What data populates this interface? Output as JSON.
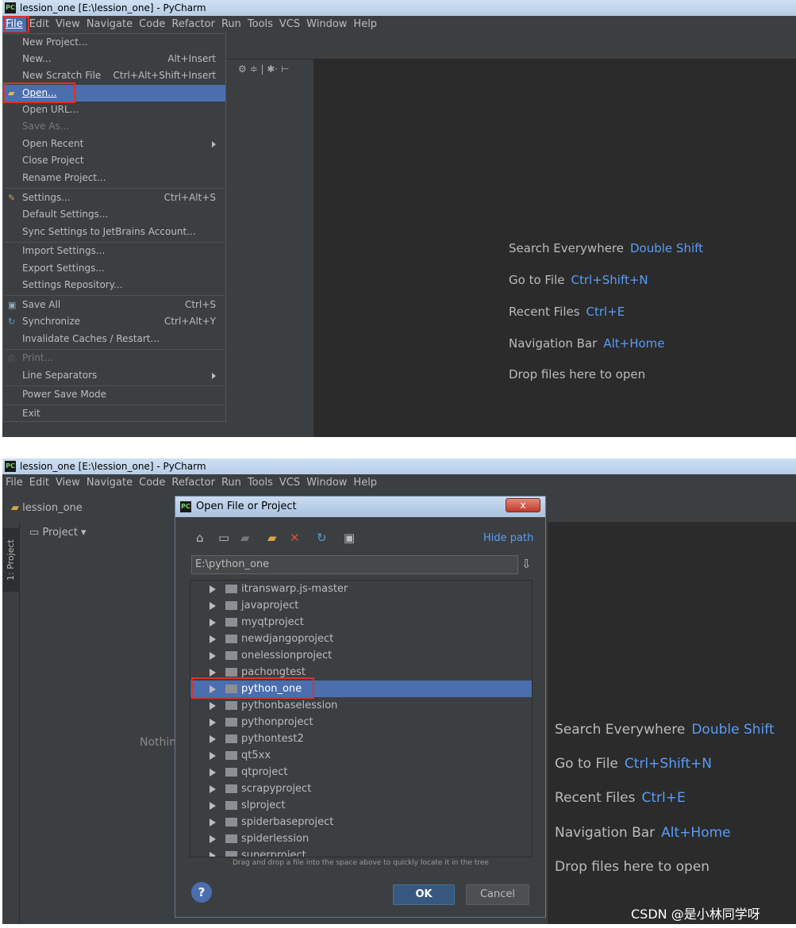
{
  "top": {
    "window_title": "lession_one [E:\\lession_one] - PyCharm",
    "menus": [
      "File",
      "Edit",
      "View",
      "Navigate",
      "Code",
      "Refactor",
      "Run",
      "Tools",
      "VCS",
      "Window",
      "Help"
    ],
    "file_menu": [
      {
        "label": "New Project...",
        "shortcut": ""
      },
      {
        "label": "New...",
        "shortcut": "Alt+Insert"
      },
      {
        "label": "New Scratch File",
        "shortcut": "Ctrl+Alt+Shift+Insert"
      },
      {
        "label": "Open...",
        "shortcut": ""
      },
      {
        "label": "Open URL...",
        "shortcut": ""
      },
      {
        "label": "Save As...",
        "shortcut": ""
      },
      {
        "label": "Open Recent",
        "shortcut": ""
      },
      {
        "label": "Close Project",
        "shortcut": ""
      },
      {
        "label": "Rename Project...",
        "shortcut": ""
      },
      {
        "label": "Settings...",
        "shortcut": "Ctrl+Alt+S"
      },
      {
        "label": "Default Settings...",
        "shortcut": ""
      },
      {
        "label": "Sync Settings to JetBrains Account...",
        "shortcut": ""
      },
      {
        "label": "Import Settings...",
        "shortcut": ""
      },
      {
        "label": "Export Settings...",
        "shortcut": ""
      },
      {
        "label": "Settings Repository...",
        "shortcut": ""
      },
      {
        "label": "Save All",
        "shortcut": "Ctrl+S"
      },
      {
        "label": "Synchronize",
        "shortcut": "Ctrl+Alt+Y"
      },
      {
        "label": "Invalidate Caches / Restart...",
        "shortcut": ""
      },
      {
        "label": "Print...",
        "shortcut": ""
      },
      {
        "label": "Line Separators",
        "shortcut": ""
      },
      {
        "label": "Power Save Mode",
        "shortcut": ""
      },
      {
        "label": "Exit",
        "shortcut": ""
      }
    ],
    "hints": [
      {
        "label": "Search Everywhere",
        "key": "Double Shift"
      },
      {
        "label": "Go to File",
        "key": "Ctrl+Shift+N"
      },
      {
        "label": "Recent Files",
        "key": "Ctrl+E"
      },
      {
        "label": "Navigation Bar",
        "key": "Alt+Home"
      },
      {
        "label": "Drop files here to open",
        "key": ""
      }
    ]
  },
  "bottom": {
    "window_title": "lession_one [E:\\lession_one] - PyCharm",
    "menus": [
      "File",
      "Edit",
      "View",
      "Navigate",
      "Code",
      "Refactor",
      "Run",
      "Tools",
      "VCS",
      "Window",
      "Help"
    ],
    "breadcrumb": "lession_one",
    "side_tab": "1: Project",
    "project_selector": "Project",
    "nothing_text": "Nothin",
    "dialog": {
      "title": "Open File or Project",
      "close_label": "x",
      "hide_path": "Hide path",
      "path_value": "E:\\python_one",
      "items": [
        "itranswarp.js-master",
        "javaproject",
        "myqtproject",
        "newdjangoproject",
        "onelessionproject",
        "pachongtest",
        "python_one",
        "pythonbaselession",
        "pythonproject",
        "pythontest2",
        "qt5xx",
        "qtproject",
        "scrapyproject",
        "slproject",
        "spiderbaseproject",
        "spiderlession",
        "superproject"
      ],
      "selected_item": "python_one",
      "drag_hint": "Drag and drop a file into the space above to quickly locate it in the tree",
      "help_label": "?",
      "ok_label": "OK",
      "cancel_label": "Cancel"
    },
    "hints": [
      {
        "label": "Search Everywhere",
        "key": "Double Shift"
      },
      {
        "label": "Go to File",
        "key": "Ctrl+Shift+N"
      },
      {
        "label": "Recent Files",
        "key": "Ctrl+E"
      },
      {
        "label": "Navigation Bar",
        "key": "Alt+Home"
      },
      {
        "label": "Drop files here to open",
        "key": ""
      }
    ]
  },
  "watermark": "CSDN @是小林同学呀",
  "colors": {
    "accent": "#4b6eaf",
    "hint_key": "#589df6",
    "highlight_box": "#e0302a",
    "background": "#2b2b2b"
  }
}
